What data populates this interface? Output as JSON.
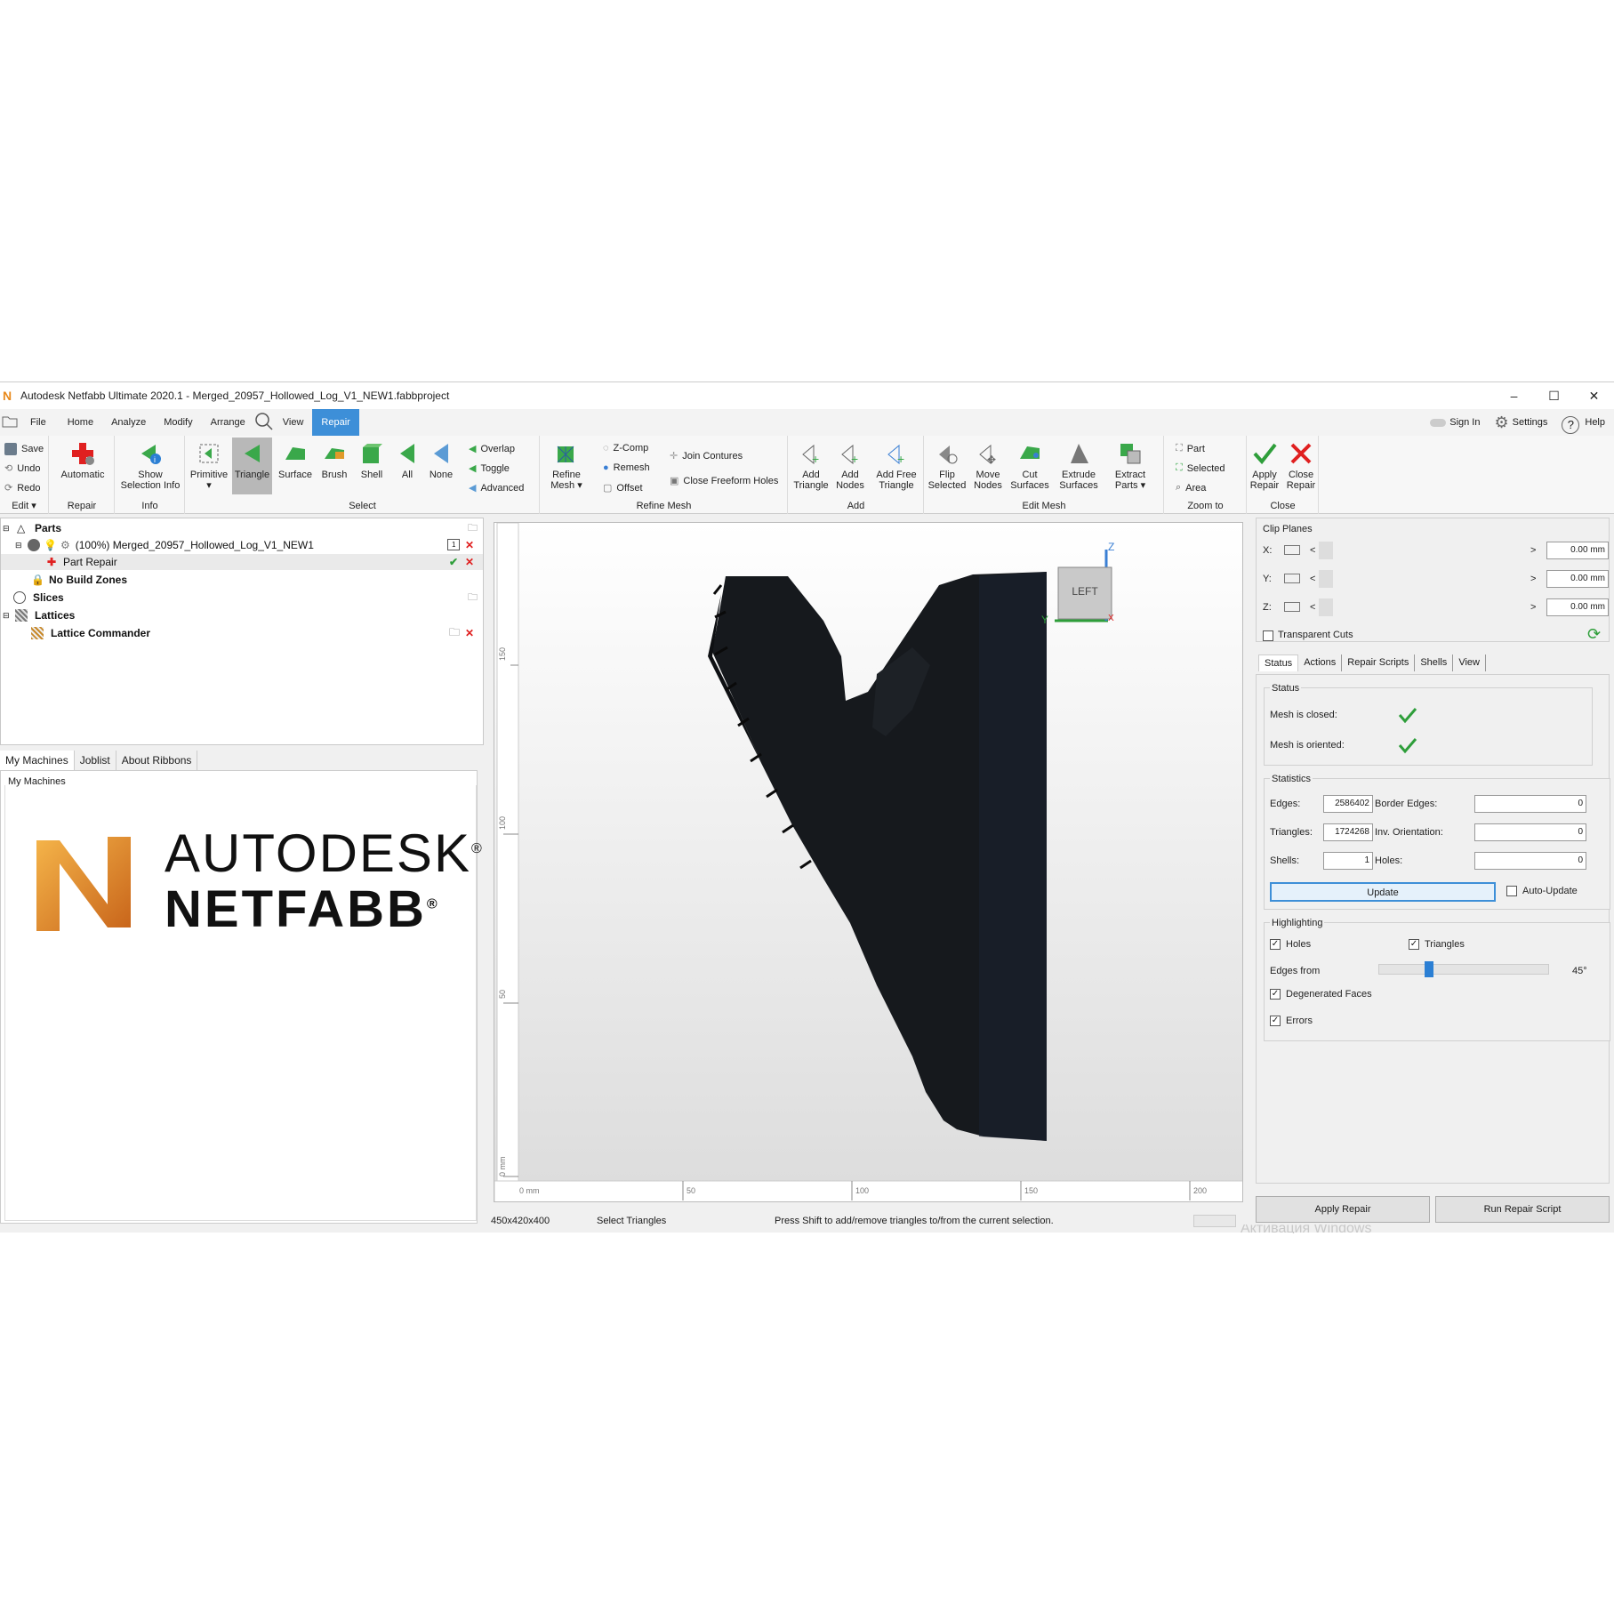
{
  "window": {
    "title": "Autodesk Netfabb Ultimate 2020.1 - Merged_20957_Hollowed_Log_V1_NEW1.fabbproject",
    "logo": "N",
    "minimize": "–",
    "maximize": "☐",
    "close": "✕"
  },
  "menu": {
    "items": [
      "File",
      "Home",
      "Analyze",
      "Modify",
      "Arrange",
      "View",
      "Repair"
    ],
    "sign_in": "Sign In",
    "settings": "Settings",
    "help": "Help"
  },
  "ribbon": {
    "edit": {
      "save": "Save",
      "undo": "Undo",
      "redo": "Redo",
      "label": "Edit ▾"
    },
    "repair": {
      "automatic": "Automatic",
      "label": "Repair"
    },
    "info": {
      "show_selection_info": "Show Selection Info",
      "label": "Info"
    },
    "select": {
      "primitive": "Primitive",
      "triangle": "Triangle",
      "surface": "Surface",
      "brush": "Brush",
      "shell": "Shell",
      "all": "All",
      "none": "None",
      "overlap": "Overlap",
      "toggle": "Toggle",
      "advanced": "Advanced",
      "label": "Select"
    },
    "refine": {
      "refine_mesh": "Refine Mesh",
      "zcomp": "Z-Comp",
      "remesh": "Remesh",
      "offset": "Offset",
      "join_contures": "Join Contures",
      "close_freeform_holes": "Close Freeform Holes",
      "label": "Refine Mesh"
    },
    "add": {
      "add_triangle": "Add Triangle",
      "add_nodes": "Add Nodes",
      "add_free_triangle": "Add Free Triangle",
      "label": "Add"
    },
    "edit_mesh": {
      "flip_selected": "Flip Selected",
      "move_nodes": "Move Nodes",
      "cut_surfaces": "Cut Surfaces",
      "extrude_surfaces": "Extrude Surfaces",
      "extract_parts": "Extract Parts",
      "label": "Edit Mesh"
    },
    "zoom": {
      "part": "Part",
      "selected": "Selected",
      "area": "Area",
      "label": "Zoom to"
    },
    "close": {
      "apply_repair": "Apply Repair",
      "close_repair": "Close Repair",
      "label": "Close"
    }
  },
  "tree": {
    "parts": "Parts",
    "part_name": "(100%) Merged_20957_Hollowed_Log_V1_NEW1",
    "part_repair": "Part Repair",
    "no_build_zones": "No Build Zones",
    "slices": "Slices",
    "lattices": "Lattices",
    "lattice_commander": "Lattice Commander",
    "part_badge": "1"
  },
  "left_tabs": [
    "My Machines",
    "Joblist",
    "About Ribbons"
  ],
  "machines": {
    "title": "My Machines",
    "brand_line1": "AUTODESK",
    "brand_line2": "NETFABB",
    "reg": "®"
  },
  "viewport": {
    "view_cube": "LEFT",
    "axis_z": "Z",
    "axis_y": "Y",
    "axis_x": "X",
    "ruler_x": [
      "0 mm",
      "50",
      "100",
      "150",
      "200"
    ],
    "ruler_y": [
      "150",
      "100",
      "50",
      "0 mm"
    ]
  },
  "status": {
    "dims": "450x420x400",
    "mode": "Select Triangles",
    "hint": "Press Shift to add/remove triangles to/from the current selection.",
    "watermark": "Активация Windows"
  },
  "clip": {
    "title": "Clip Planes",
    "x_label": "X:",
    "y_label": "Y:",
    "z_label": "Z:",
    "x_value": "0.00 mm",
    "y_value": "0.00 mm",
    "z_value": "0.00 mm",
    "lt": "<",
    "gt": ">",
    "transparent_cuts": "Transparent Cuts"
  },
  "tabs": [
    "Status",
    "Actions",
    "Repair Scripts",
    "Shells",
    "View"
  ],
  "status_panel": {
    "title": "Status",
    "mesh_closed": "Mesh is closed:",
    "mesh_oriented": "Mesh is oriented:"
  },
  "statistics": {
    "title": "Statistics",
    "edges_label": "Edges:",
    "edges": "2586402",
    "border_edges_label": "Border Edges:",
    "border_edges": "0",
    "triangles_label": "Triangles:",
    "triangles": "1724268",
    "inv_orientation_label": "Inv. Orientation:",
    "inv_orientation": "0",
    "shells_label": "Shells:",
    "shells": "1",
    "holes_label": "Holes:",
    "holes": "0",
    "update": "Update",
    "auto_update": "Auto-Update"
  },
  "highlighting": {
    "title": "Highlighting",
    "holes": "Holes",
    "triangles": "Triangles",
    "edges_from": "Edges from",
    "angle": "45°",
    "angle_fraction": 0.28,
    "degenerated_faces": "Degenerated Faces",
    "errors": "Errors"
  },
  "bottom_buttons": {
    "apply_repair": "Apply Repair",
    "run_repair_script": "Run Repair Script"
  },
  "colors": {
    "accent": "#3d8fd8",
    "green": "#2e9e3a",
    "red": "#e02020",
    "brand_orange": "#e8891b"
  }
}
